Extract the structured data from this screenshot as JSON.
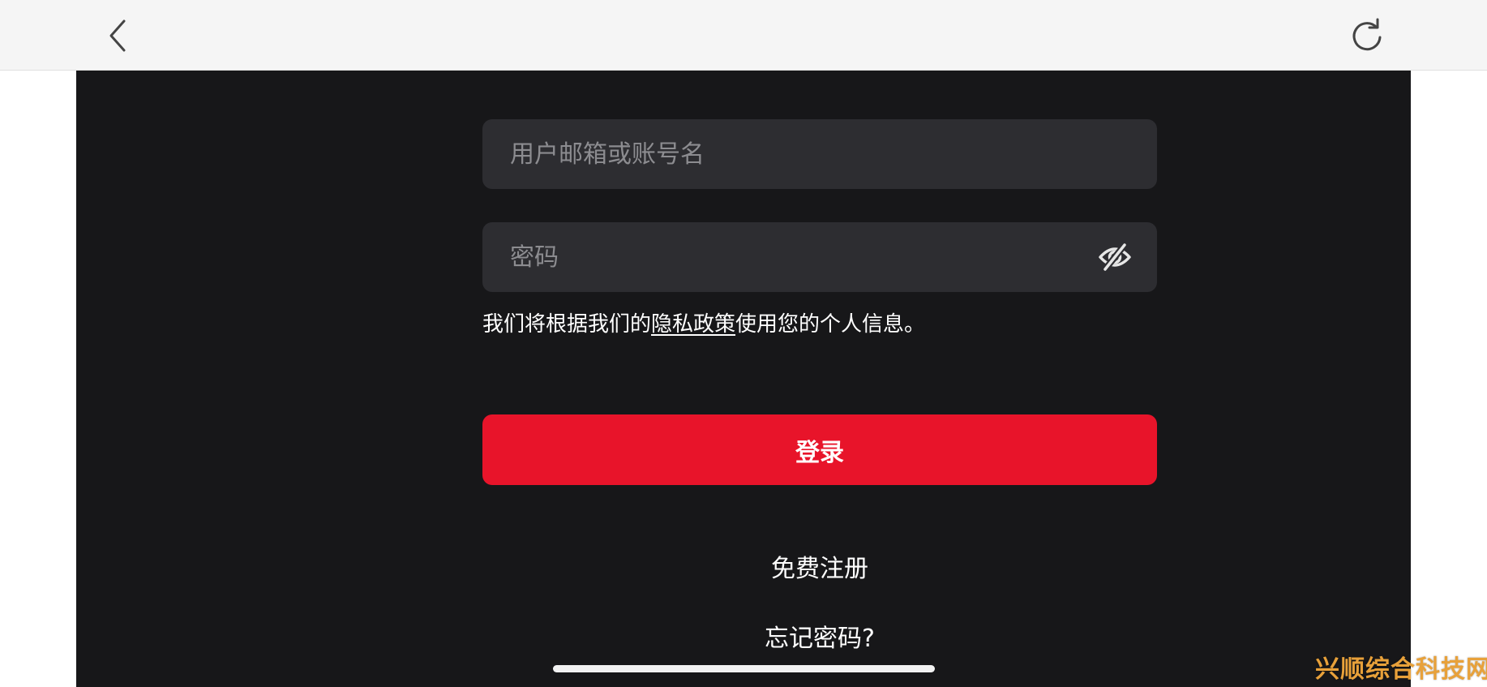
{
  "topbar": {
    "back_icon": "chevron-left-icon",
    "reload_icon": "refresh-icon"
  },
  "form": {
    "username": {
      "placeholder": "用户邮箱或账号名",
      "value": ""
    },
    "password": {
      "placeholder": "密码",
      "value": "",
      "toggle_icon": "eye-off-icon"
    },
    "privacy": {
      "prefix": "我们将根据我们的",
      "link": "隐私政策",
      "suffix": "使用您的个人信息。"
    },
    "login_label": "登录",
    "signup_label": "免费注册",
    "forgot_label": "忘记密码?"
  },
  "watermark": "兴顺综合科技网",
  "colors": {
    "panel_bg": "#171719",
    "field_bg": "#2d2d31",
    "accent": "#e8142a",
    "topbar_bg": "#f5f5f5"
  }
}
